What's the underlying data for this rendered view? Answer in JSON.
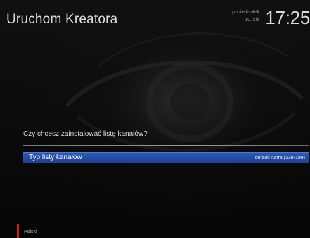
{
  "header": {
    "title": "Uruchom Kreatora",
    "day": "poniedziałek",
    "date": "10. sie",
    "time": "17:25"
  },
  "main": {
    "question": "Czy chcesz zainstalować listę kanałów?",
    "setting": {
      "label": "Typ listy kanałów",
      "value": "default Astra (13e-19e)"
    }
  },
  "footer": {
    "red_key_color": "#d21d1d",
    "language_label": "Polski"
  },
  "colors": {
    "selection": "#2a52ac",
    "background": "#0b0b0b"
  }
}
